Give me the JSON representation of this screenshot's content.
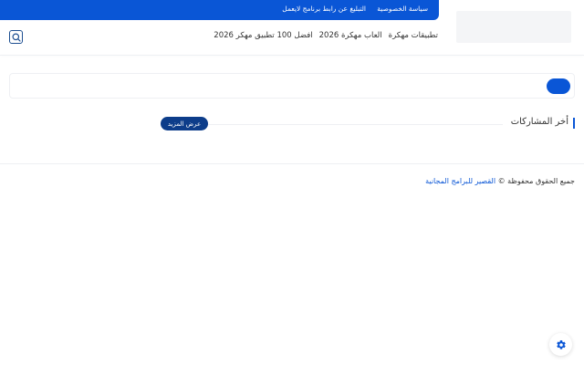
{
  "topbar": {
    "links": [
      {
        "label": "سياسة الخصوصية"
      },
      {
        "label": "التبليغ عن رابط برنامج لايعمل"
      }
    ]
  },
  "nav": {
    "items": [
      {
        "label": "افضل 100 تطبيق مهكر 2026"
      },
      {
        "label": "العاب مهكرة 2026"
      },
      {
        "label": "تطبيقات مهكرة"
      }
    ]
  },
  "search": {
    "placeholder": "",
    "value": ""
  },
  "posts": {
    "title": "أخر المشاركات",
    "more_label": "عرض المزيد"
  },
  "footer": {
    "rights": "جميع الحقوق محفوظة ©",
    "brand": "القصير للبرامج المجانية"
  },
  "colors": {
    "primary": "#0a56d6",
    "dark_button": "#0d3d8a"
  },
  "icons": {
    "search": "search-icon",
    "settings": "gear-icon"
  }
}
